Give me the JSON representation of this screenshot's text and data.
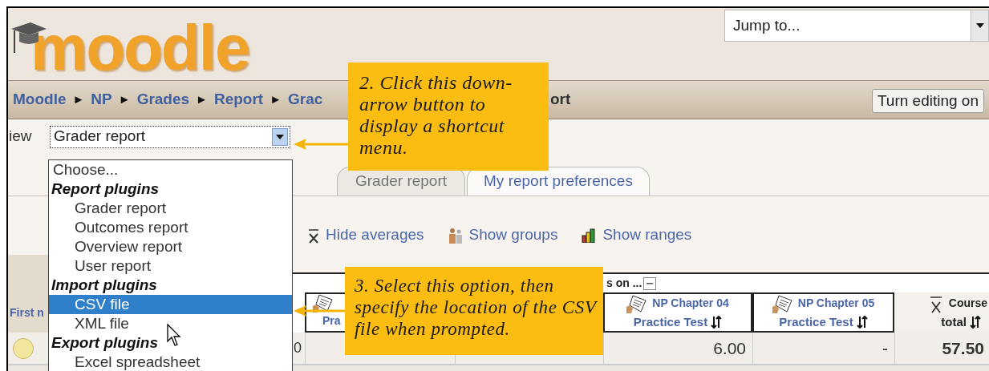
{
  "logo": {
    "text": "moodle"
  },
  "jump_menu": {
    "value": "Jump to..."
  },
  "breadcrumb": [
    {
      "kind": "link",
      "text": "Moodle"
    },
    {
      "kind": "separator",
      "text": "►"
    },
    {
      "kind": "link",
      "text": "NP"
    },
    {
      "kind": "separator",
      "text": "►"
    },
    {
      "kind": "link",
      "text": "Grades"
    },
    {
      "kind": "separator",
      "text": "►"
    },
    {
      "kind": "link",
      "text": "Report"
    },
    {
      "kind": "separator",
      "text": "►"
    },
    {
      "kind": "link",
      "text": "Grac"
    }
  ],
  "breadcrumb_current_fragment": "ort",
  "editing_button": "Turn editing on",
  "view": {
    "label": "iew",
    "value": "Grader report"
  },
  "view_menu": [
    {
      "kind": "option",
      "text": "Choose...",
      "selected": false
    },
    {
      "kind": "group",
      "text": "Report plugins"
    },
    {
      "kind": "option",
      "text": "Grader report",
      "selected": false
    },
    {
      "kind": "option",
      "text": "Outcomes report",
      "selected": false
    },
    {
      "kind": "option",
      "text": "Overview report",
      "selected": false
    },
    {
      "kind": "option",
      "text": "User report",
      "selected": false
    },
    {
      "kind": "group",
      "text": "Import plugins"
    },
    {
      "kind": "option",
      "text": "CSV file",
      "selected": true
    },
    {
      "kind": "option",
      "text": "XML file",
      "selected": false
    },
    {
      "kind": "group",
      "text": "Export plugins"
    },
    {
      "kind": "option",
      "text": "Excel spreadsheet",
      "selected": false
    }
  ],
  "tabs": [
    {
      "label": "Grader report",
      "selected": true
    },
    {
      "label": "My report preferences",
      "selected": false
    }
  ],
  "toolbar": [
    {
      "kind": "averages",
      "label": "Hide averages"
    },
    {
      "kind": "groups",
      "label": "Show groups"
    },
    {
      "kind": "ranges",
      "label": "Show ranges"
    }
  ],
  "table": {
    "group_fragment": "s on ...",
    "columns": [
      {
        "kind": "name",
        "title": "First n"
      },
      {
        "kind": "grade_item",
        "subtitle": "Pra"
      },
      {
        "kind": "grade_item",
        "title": "NP Chapter 04",
        "subtitle": "Practice Test"
      },
      {
        "kind": "grade_item",
        "title": "NP Chapter 05",
        "subtitle": "Practice Test"
      },
      {
        "kind": "course_total",
        "title": "Course",
        "subtitle": "total"
      }
    ],
    "rows": [
      {
        "column_2": "0",
        "column_5": "6.00",
        "column_6": "-",
        "column_7": "57.50"
      }
    ]
  },
  "callouts": [
    {
      "text": "2. Click this down-arrow button to display a shortcut menu."
    },
    {
      "text": "3. Select this option, then specify the location of the CSV file when prompted."
    }
  ]
}
